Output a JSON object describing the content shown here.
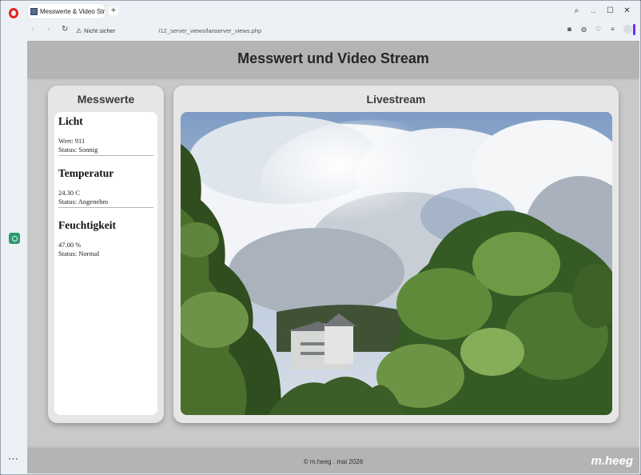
{
  "browser": {
    "tab_title": "Messwerte & Video Stream",
    "new_tab": "+",
    "security_label": "Nicht sicher",
    "url": "/12_server_views/lanserver_views.php",
    "window_controls": {
      "search": "⌕",
      "minimize": "‥",
      "maximize": "☐",
      "close": "✕"
    },
    "sidebar_more": "⋯"
  },
  "page": {
    "title": "Messwert und Video Stream",
    "measures_title": "Messwerte",
    "stream_title": "Livestream",
    "measures": [
      {
        "name": "Licht",
        "value": "Wert: 911",
        "status": "Status: Sonnig"
      },
      {
        "name": "Temperatur",
        "value": "24.30 C",
        "status": "Status: Angenehm"
      },
      {
        "name": "Feuchtigkeit",
        "value": "47.00 %",
        "status": "Status: Normal"
      }
    ],
    "footer": "© m.heeg . mai 2026",
    "footer_brand": "m.heeg"
  },
  "colors": {
    "header_bg": "#b4b4b4",
    "page_bg": "#c9c9c9",
    "card_bg": "#e6e6e6",
    "opera_red": "#e0261c",
    "opera_accent": "#6a2cff"
  }
}
